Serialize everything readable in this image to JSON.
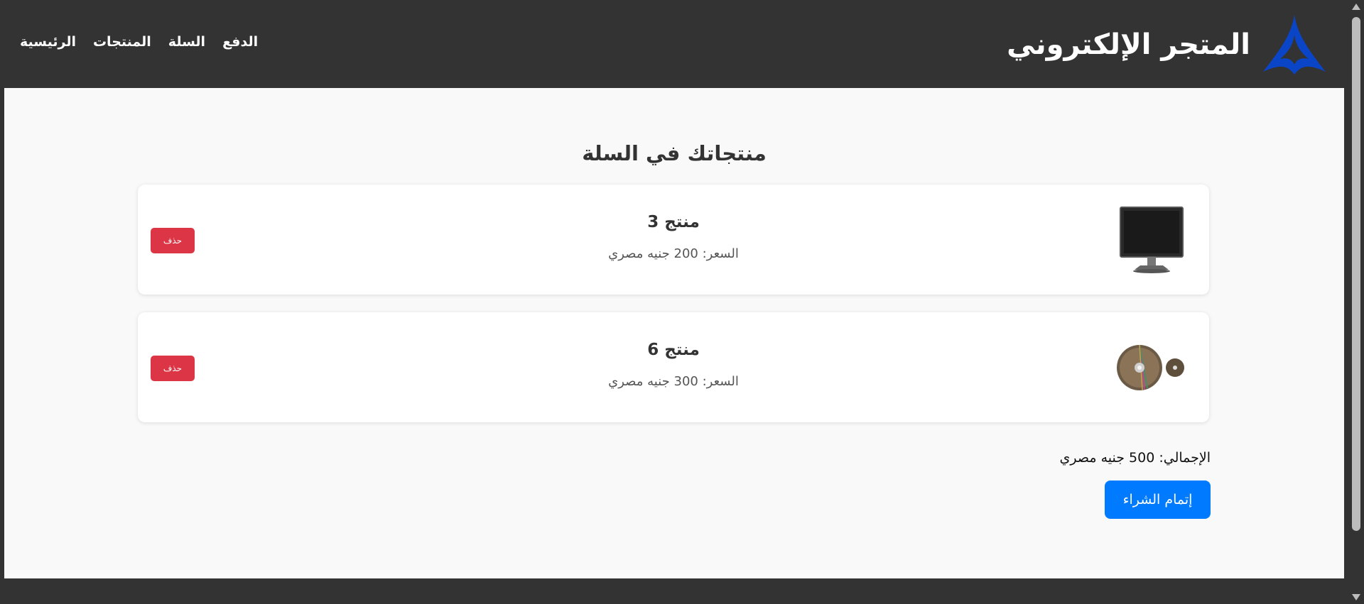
{
  "header": {
    "site_title": "المتجر الإلكتروني",
    "logo_icon": "star-logo-icon",
    "brand_color": "#0a45c7",
    "nav": [
      {
        "label": "الرئيسية"
      },
      {
        "label": "المنتجات"
      },
      {
        "label": "السلة"
      },
      {
        "label": "الدفع"
      }
    ]
  },
  "main": {
    "cart_title": "منتجاتك في السلة",
    "items": [
      {
        "name": "منتج 3",
        "price": "السعر: 200 جنيه مصري",
        "image_icon": "monitor-icon",
        "delete_label": "حذف"
      },
      {
        "name": "منتج 6",
        "price": "السعر: 300 جنيه مصري",
        "image_icon": "disc-icon",
        "delete_label": "حذف"
      }
    ],
    "total": "الإجمالي: 500 جنيه مصري",
    "checkout_label": "إتمام الشراء"
  },
  "colors": {
    "header_bg": "#333333",
    "page_bg": "#f9f9f9",
    "delete_button": "#dc3545",
    "checkout_button": "#007bff"
  }
}
